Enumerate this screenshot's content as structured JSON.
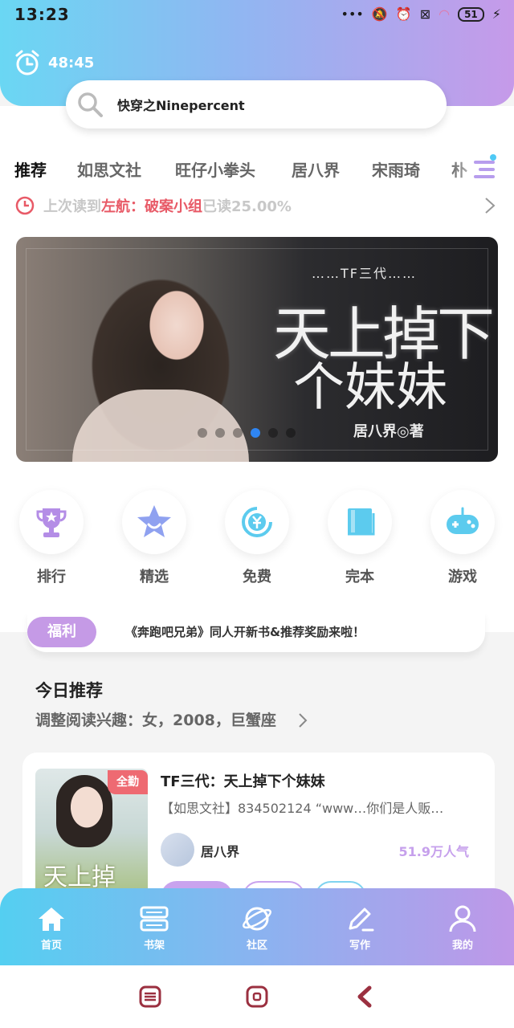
{
  "status_bar": {
    "time": "13:23",
    "battery": "51"
  },
  "timer": {
    "value": "48:45"
  },
  "search": {
    "query": "快穿之Ninepercent"
  },
  "tabs": [
    "推荐",
    "如思文社",
    "旺仔小拳头",
    "居八界",
    "宋雨琦",
    "朴"
  ],
  "last_read": {
    "prefix": "上次读到",
    "book": "左航：破案小组",
    "suffix": "已读25.00%"
  },
  "banner": {
    "series": "……TF三代……",
    "title_line1": "天上掉下",
    "title_line2": "个妹妹",
    "author": "居八界◎著"
  },
  "categories": [
    {
      "label": "排行",
      "icon": "trophy-icon"
    },
    {
      "label": "精选",
      "icon": "star-icon"
    },
    {
      "label": "免费",
      "icon": "yuan-refresh-icon"
    },
    {
      "label": "完本",
      "icon": "book-icon"
    },
    {
      "label": "游戏",
      "icon": "gamepad-icon"
    }
  ],
  "notice": {
    "tag": "福利",
    "message": "《奔跑吧兄弟》同人开新书&推荐奖励来啦！"
  },
  "today": {
    "heading": "今日推荐",
    "preference": "调整阅读兴趣：女，2008，巨蟹座"
  },
  "book_card": {
    "badge": "全勤",
    "cover_text": "天上掉",
    "title": "TF三代：天上掉下个妹妹",
    "description": "【如思文社】834502124 “www…你们是人贩…",
    "author": "居八界",
    "popularity": "51.9万人气"
  },
  "bottom_nav": [
    {
      "label": "首页",
      "icon": "home-icon"
    },
    {
      "label": "书架",
      "icon": "bookshelf-icon"
    },
    {
      "label": "社区",
      "icon": "planet-icon"
    },
    {
      "label": "写作",
      "icon": "pen-icon"
    },
    {
      "label": "我的",
      "icon": "user-icon"
    }
  ],
  "colors": {
    "accent_purple": "#c59ae6",
    "accent_blue": "#54cff1",
    "highlight_red": "#e85a67"
  }
}
